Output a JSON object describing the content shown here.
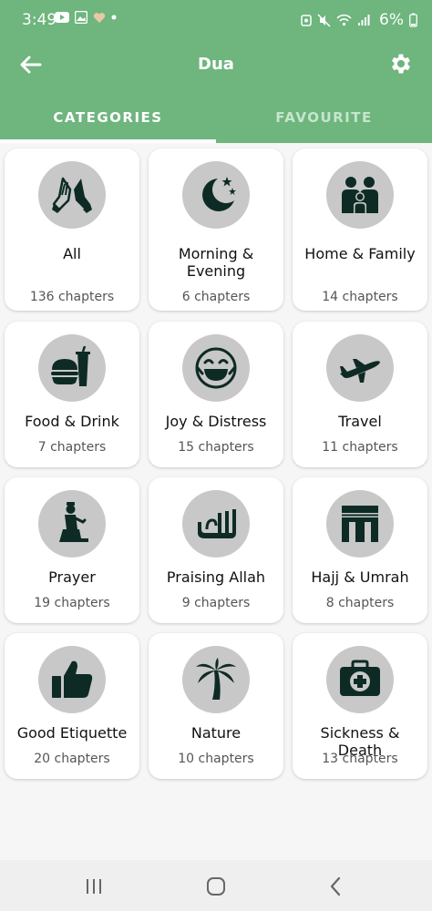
{
  "status": {
    "time": "3:49",
    "battery": "6%"
  },
  "appbar": {
    "title": "Dua"
  },
  "tabs": [
    {
      "label": "CATEGORIES"
    },
    {
      "label": "FAVOURITE"
    }
  ],
  "categories": [
    {
      "name": "All",
      "count": "136 chapters",
      "icon": "praying-hands-icon"
    },
    {
      "name": "Morning & Evening",
      "count": "6 chapters",
      "icon": "moon-stars-icon"
    },
    {
      "name": "Home & Family",
      "count": "14 chapters",
      "icon": "family-icon"
    },
    {
      "name": "Food & Drink",
      "count": "7 chapters",
      "icon": "burger-drink-icon"
    },
    {
      "name": "Joy & Distress",
      "count": "15 chapters",
      "icon": "laughing-face-icon"
    },
    {
      "name": "Travel",
      "count": "11 chapters",
      "icon": "airplane-icon"
    },
    {
      "name": "Prayer",
      "count": "19 chapters",
      "icon": "praying-person-icon"
    },
    {
      "name": "Praising Allah",
      "count": "9 chapters",
      "icon": "allah-calligraphy-icon"
    },
    {
      "name": "Hajj & Umrah",
      "count": "8 chapters",
      "icon": "kaaba-icon"
    },
    {
      "name": "Good Etiquette",
      "count": "20 chapters",
      "icon": "thumbs-up-icon"
    },
    {
      "name": "Nature",
      "count": "10 chapters",
      "icon": "palm-tree-icon"
    },
    {
      "name": "Sickness & Death",
      "count": "13 chapters",
      "icon": "first-aid-kit-icon"
    }
  ],
  "colors": {
    "accent": "#6eb57e",
    "icon": "#0d2b24",
    "icon_bg": "#c8c8c8"
  }
}
